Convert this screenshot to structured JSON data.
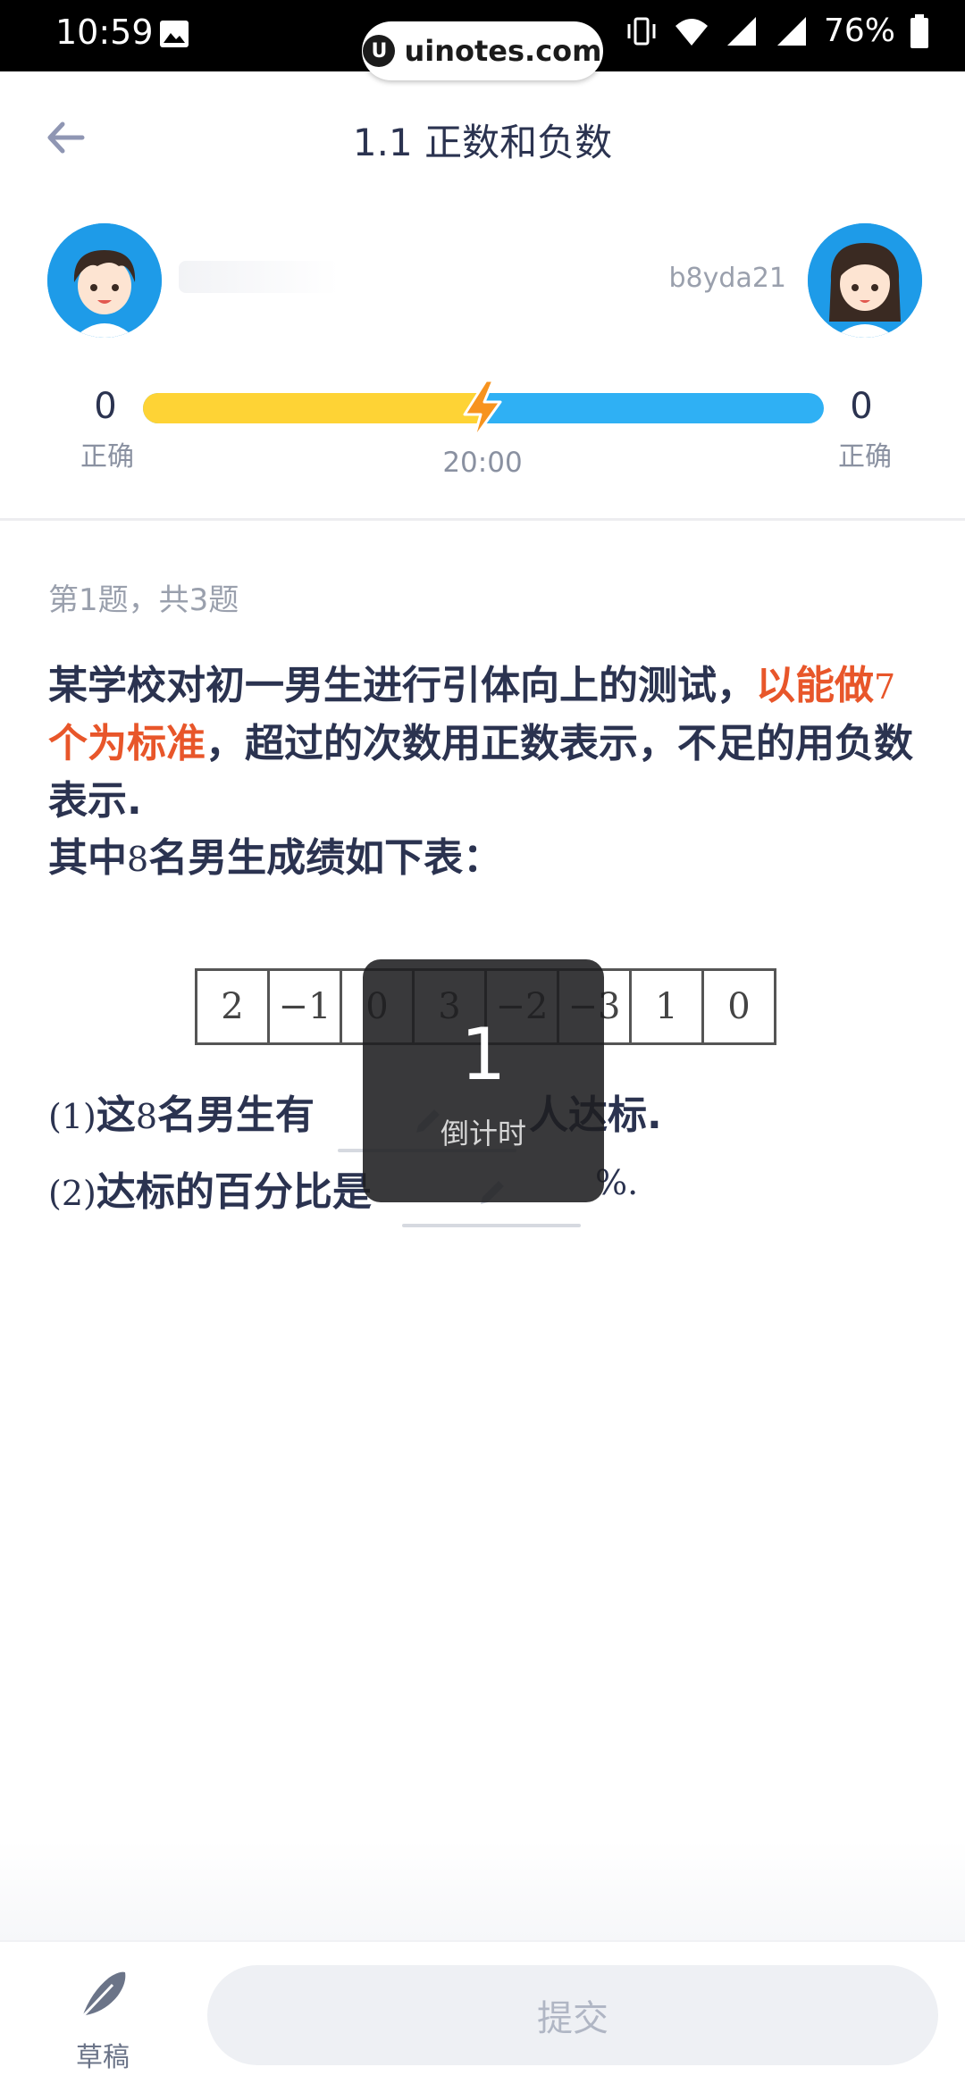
{
  "status_bar": {
    "time": "10:59",
    "battery": "76%"
  },
  "watermark": {
    "text": "uinotes.com"
  },
  "header": {
    "title": "1.1 正数和负数"
  },
  "players": {
    "right_name": "b8yda21",
    "left_score": "0",
    "right_score": "0",
    "score_label": "正确",
    "timer": "20:00",
    "left_progress_fraction": 0.5,
    "left_color": "#fed335",
    "right_color": "#2fb0f4"
  },
  "question": {
    "progress": "第1题，共3题",
    "part1": "某学校对初一男生进行引体向上的测试，",
    "highlight_a": "以能做",
    "highlight_num": "7",
    "highlight_b": "个为标准",
    "part2": "，超过的次数用正数表示，不足的用负数表示.",
    "line2_a": "其中",
    "line2_num": "8",
    "line2_b": "名男生成绩如下表：",
    "table": [
      "2",
      "−1",
      "0",
      "3",
      "−2",
      "−3",
      "1",
      "0"
    ],
    "sub1_num": "(1)",
    "sub1_a": "这",
    "sub1_n": "8",
    "sub1_b": "名男生有",
    "sub1_tail": "人达标.",
    "sub2_num": "(2)",
    "sub2_text": "达标的百分比是",
    "sub2_tail": "%."
  },
  "countdown": {
    "value": "1",
    "label": "倒计时"
  },
  "bottom": {
    "draft_label": "草稿",
    "submit_label": "提交"
  }
}
